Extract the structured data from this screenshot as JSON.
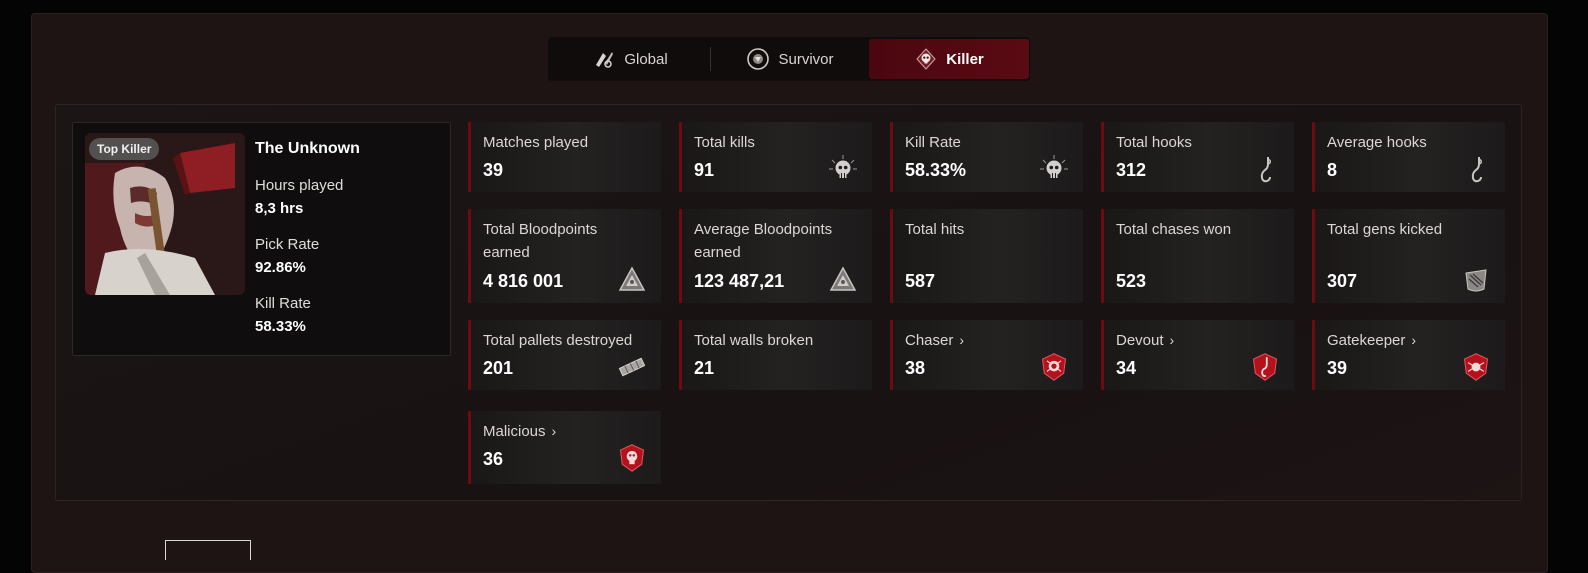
{
  "tabs": [
    {
      "label": "Global",
      "icon": "global-icon",
      "active": false
    },
    {
      "label": "Survivor",
      "icon": "survivor-icon",
      "active": false
    },
    {
      "label": "Killer",
      "icon": "killer-skull-icon",
      "active": true
    }
  ],
  "profile": {
    "badge": "Top Killer",
    "name": "The Unknown",
    "hours_label": "Hours played",
    "hours_value": "8,3 hrs",
    "pick_label": "Pick Rate",
    "pick_value": "92.86%",
    "kill_label": "Kill Rate",
    "kill_value": "58.33%"
  },
  "stats": [
    {
      "label": "Matches played",
      "value": "39",
      "icon": ""
    },
    {
      "label": "Total kills",
      "value": "91",
      "icon": "skull-icon"
    },
    {
      "label": "Kill Rate",
      "value": "58.33%",
      "icon": "skull-icon"
    },
    {
      "label": "Total hooks",
      "value": "312",
      "icon": "hook-icon"
    },
    {
      "label": "Average hooks",
      "value": "8",
      "icon": "hook-icon"
    },
    {
      "label": "Total Bloodpoints earned",
      "value": "4 816 001",
      "icon": "bloodpoints-icon"
    },
    {
      "label": "Average Bloodpoints earned",
      "value": "123 487,21",
      "icon": "bloodpoints-icon"
    },
    {
      "label": "Total hits",
      "value": "587",
      "icon": ""
    },
    {
      "label": "Total chases won",
      "value": "523",
      "icon": ""
    },
    {
      "label": "Total gens kicked",
      "value": "307",
      "icon": "generator-icon"
    },
    {
      "label": "Total pallets destroyed",
      "value": "201",
      "icon": "pallet-icon"
    },
    {
      "label": "Total walls broken",
      "value": "21",
      "icon": ""
    },
    {
      "label": "Chaser",
      "value": "38",
      "icon": "achievement-emblem-icon",
      "link": true
    },
    {
      "label": "Devout",
      "value": "34",
      "icon": "achievement-emblem-icon",
      "link": true
    },
    {
      "label": "Gatekeeper",
      "value": "39",
      "icon": "achievement-emblem-icon",
      "link": true
    },
    {
      "label": "Malicious",
      "value": "36",
      "icon": "achievement-emblem-icon",
      "link": true
    }
  ],
  "colors": {
    "accent": "#6e0b12",
    "active_tab": "#4a0710",
    "panel": "#1f1414"
  }
}
